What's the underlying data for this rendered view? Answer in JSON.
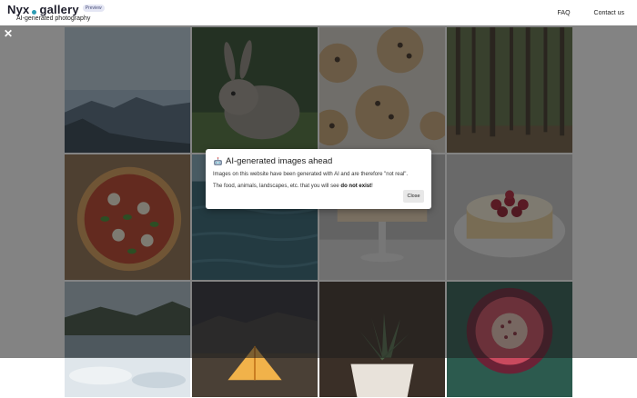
{
  "header": {
    "logo_part1": "Nyx",
    "logo_part2": "gallery",
    "preview_badge": "Preview",
    "tagline": "AI-generated photography",
    "nav": [
      "FAQ",
      "Contact us"
    ]
  },
  "overlay": {
    "close_symbol": "✕"
  },
  "modal": {
    "title": "AI-generated images ahead",
    "line1": "Images on this website have been generated with AI and are therefore \"not real\".",
    "line2_prefix": "The food, animals, landscapes, etc. that you will see ",
    "line2_bold": "do not exist",
    "line2_suffix": "!",
    "close_label": "Close"
  },
  "gallery": {
    "tiles": [
      "mountain-lake-landscape",
      "rabbit",
      "chocolate-chip-cookies",
      "forest",
      "pizza",
      "ocean-water",
      "cake-on-stand",
      "berry-cheesecake",
      "mountain-lake-reflection",
      "tent-at-night",
      "potted-succulent",
      "fig-slice"
    ]
  },
  "colors": {
    "accent": "#2b9bb3",
    "overlay": "rgba(30,30,30,0.55)"
  }
}
